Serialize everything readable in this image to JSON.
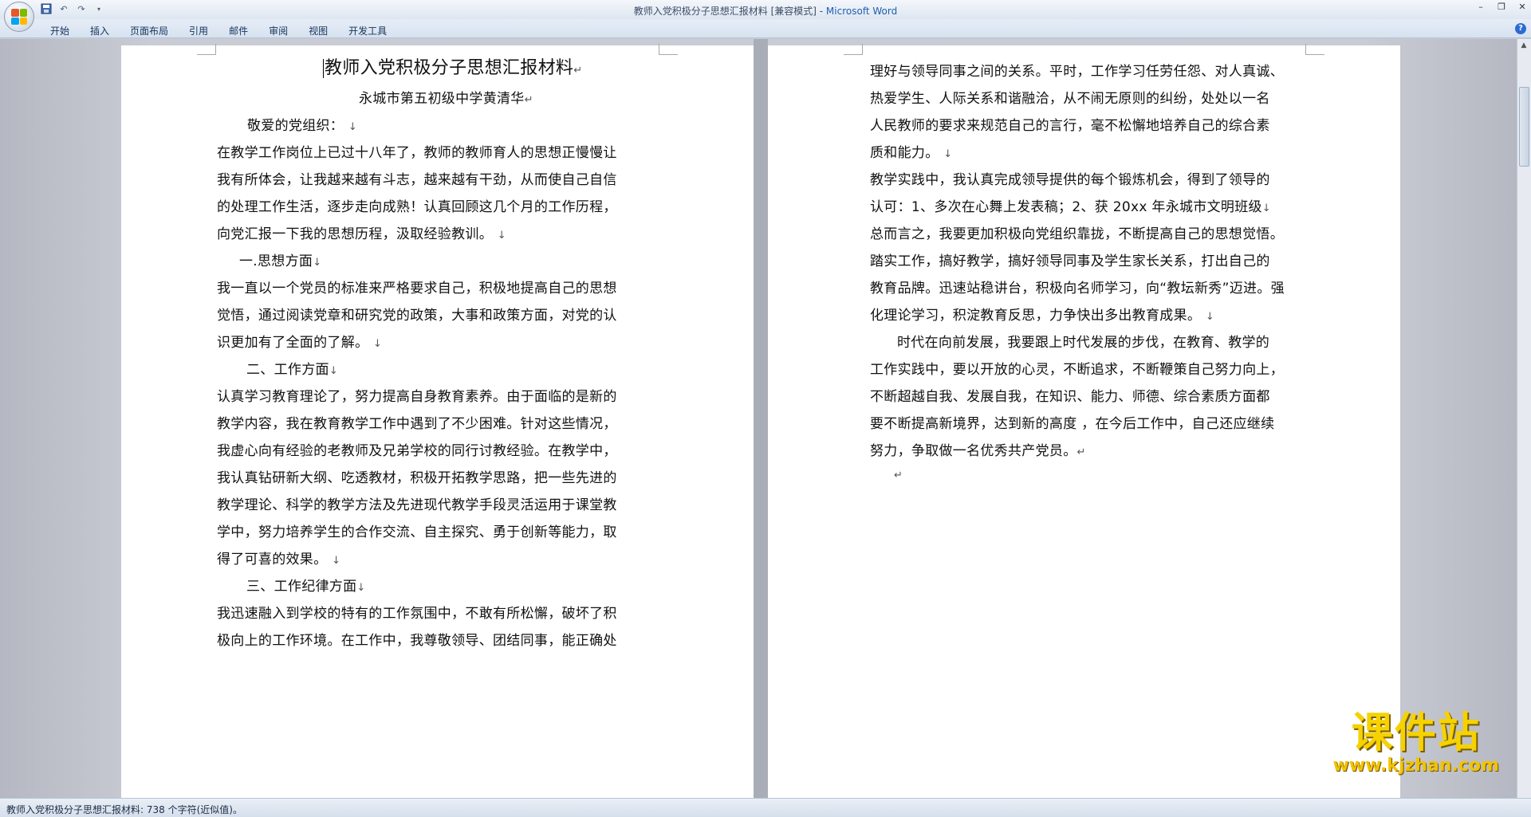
{
  "window": {
    "title_doc": "教师入党积极分子思想汇报材料 [兼容模式] - ",
    "title_app": "Microsoft Word"
  },
  "ribbon": {
    "tabs": [
      {
        "label": "开始"
      },
      {
        "label": "插入"
      },
      {
        "label": "页面布局"
      },
      {
        "label": "引用"
      },
      {
        "label": "邮件"
      },
      {
        "label": "审阅"
      },
      {
        "label": "视图"
      },
      {
        "label": "开发工具"
      }
    ]
  },
  "icons": {
    "office_button": "office-logo-icon",
    "save": "save-icon",
    "undo": "undo-icon",
    "redo": "redo-icon",
    "customize": "chevron-down-icon",
    "help": "help-icon"
  },
  "page_left": {
    "title": "教师入党积极分子思想汇报材料",
    "subtitle": "永城市第五初级中学黄清华",
    "lines": [
      "敬爱的党组织：",
      "在教学工作岗位上已过十八年了，教师的教师育人的思想正慢慢让",
      "我有所体会，让我越来越有斗志，越来越有干劲，从而使自己自信",
      "的处理工作生活，逐步走向成熟！认真回顾这几个月的工作历程，",
      "向党汇报一下我的思想历程，汲取经验教训。",
      "一.思想方面",
      "我一直以一个党员的标准来严格要求自己，积极地提高自己的思想",
      "觉悟，通过阅读党章和研究党的政策，大事和政策方面，对党的认",
      "识更加有了全面的了解。",
      "二、工作方面",
      "认真学习教育理论了，努力提高自身教育素养。由于面临的是新的",
      "教学内容，我在教育教学工作中遇到了不少困难。针对这些情况，",
      "我虚心向有经验的老教师及兄弟学校的同行讨教经验。在教学中，",
      "我认真钻研新大纲、吃透教材，积极开拓教学思路，把一些先进的",
      "教学理论、科学的教学方法及先进现代教学手段灵活运用于课堂教",
      "学中，努力培养学生的合作交流、自主探究、勇于创新等能力，取",
      "得了可喜的效果。",
      "三、工作纪律方面",
      "我迅速融入到学校的特有的工作氛围中，不敢有所松懈，破坏了积",
      "极向上的工作环境。在工作中，我尊敬领导、团结同事，能正确处"
    ]
  },
  "page_right": {
    "lines": [
      "理好与领导同事之间的关系。平时，工作学习任劳任怨、对人真诚、",
      "热爱学生、人际关系和谐融洽，从不闹无原则的纠纷，处处以一名",
      "人民教师的要求来规范自己的言行，毫不松懈地培养自己的综合素",
      "质和能力。",
      "教学实践中，我认真完成领导提供的每个锻炼机会，得到了领导的",
      "认可：1、多次在心舞上发表稿；2、获 20xx 年永城市文明班级",
      "总而言之，我要更加积极向党组织靠拢，不断提高自己的思想觉悟。",
      "踏实工作，搞好教学，搞好领导同事及学生家长关系，打出自己的",
      "教育品牌。迅速站稳讲台，积极向名师学习，向“教坛新秀”迈进。强",
      "化理论学习，积淀教育反思，力争快出多出教育成果。",
      "时代在向前发展，我要跟上时代发展的步伐，在教育、教学的",
      "工作实践中，要以开放的心灵，不断追求，不断鞭策自己努力向上，",
      "不断超越自我、发展自我，在知识、能力、师德、综合素质方面都",
      "要不断提高新境界，达到新的高度 ，在今后工作中，自己还应继续",
      "努力，争取做一名优秀共产党员。"
    ]
  },
  "marks": {
    "para": "↵",
    "line": "↓"
  },
  "statusbar": {
    "text": "教师入党积极分子思想汇报材料: 738 个字符(近似值)。"
  },
  "watermark": {
    "main": "课件站",
    "url": "www.kjzhan.com"
  }
}
